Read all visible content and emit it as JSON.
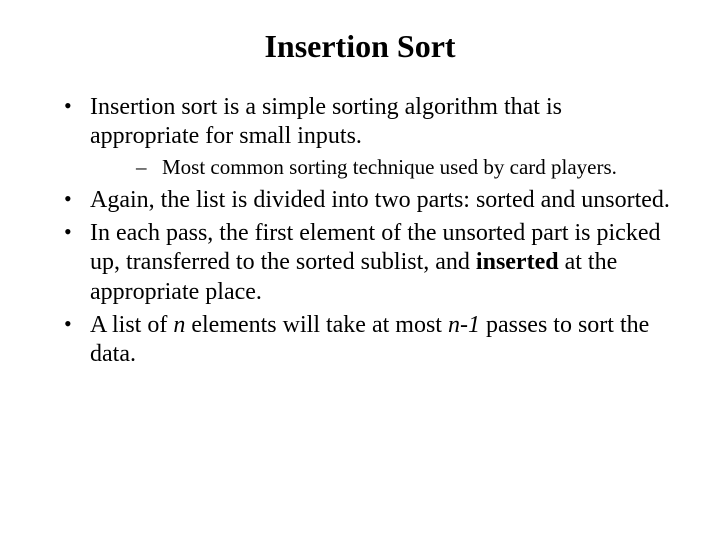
{
  "title": "Insertion Sort",
  "bullets": {
    "b1_pre": "Insertion sort is a simple sorting algorithm that is appropriate for small inputs.",
    "b1_sub1": "Most common sorting technique used by card players.",
    "b2": "Again, the list is divided into two parts: sorted and unsorted.",
    "b3_part1": "In each pass, the first element of the unsorted part is picked up, transferred to the sorted sublist, and ",
    "b3_bold": "inserted",
    "b3_part2": " at the appropriate place.",
    "b4_part1": "A list of ",
    "b4_it1": "n",
    "b4_part2": " elements will take at most ",
    "b4_it2": "n-1",
    "b4_part3": " passes to sort the data."
  }
}
